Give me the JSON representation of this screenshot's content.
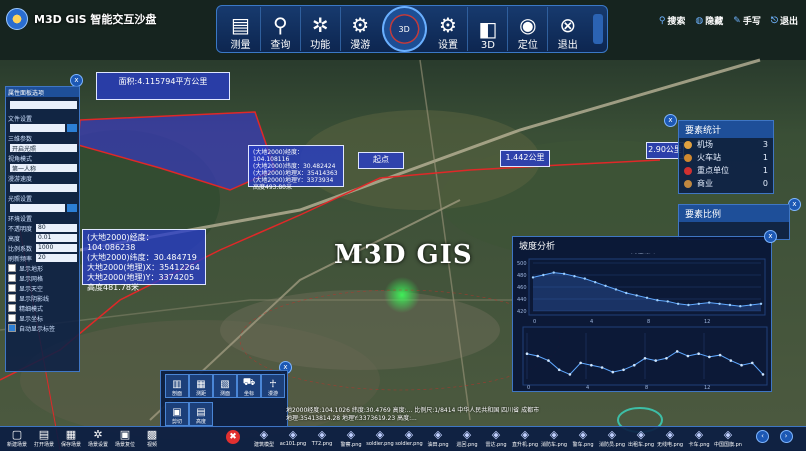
{
  "app": {
    "title": "M3D GIS 智能交互沙盘",
    "watermark": "M3D GIS"
  },
  "toolbar": {
    "items": [
      {
        "label": "测量",
        "icon": "ruler-icon"
      },
      {
        "label": "查询",
        "icon": "search-icon"
      },
      {
        "label": "功能",
        "icon": "gear-icon"
      },
      {
        "label": "漫游",
        "icon": "roam-icon"
      },
      {
        "label": "设置",
        "icon": "settings-icon"
      },
      {
        "label": "3D",
        "icon": "cube-icon"
      },
      {
        "label": "定位",
        "icon": "location-pin-icon"
      },
      {
        "label": "退出",
        "icon": "close-icon"
      }
    ],
    "dial_label": "3D"
  },
  "right_menu": [
    "搜索",
    "隐藏",
    "手写",
    "退出"
  ],
  "left_panel": {
    "title": "属性面板选项",
    "section1": "文件设置",
    "section2": "三维参数",
    "field1_value": "开启光照",
    "field2_label": "视角模式",
    "field2_value": "第一人称",
    "field3_label": "漫游速度",
    "field4_label": "光照设置",
    "field5_label": "环境设置",
    "opacity_label": "不透明度",
    "opacity_value": "80",
    "height_label": "高度",
    "height_value": "0.01",
    "scale_label": "比例系数",
    "scale_value": "1000",
    "rate_label": "刷新频率",
    "rate_value": "20",
    "checks": [
      "显示地形",
      "显示网格",
      "显示天空",
      "显示阴影线",
      "精细模式",
      "显示坐标",
      "自动显示标签"
    ]
  },
  "callouts": {
    "area": "面积:4.115794平方公里",
    "point1": [
      "(大地2000)经度：104.108116",
      "(大地2000)纬度：30.482424",
      "(大地2000)地理X：35414363",
      "(大地2000)地理Y：3373934",
      "高度493.80米"
    ],
    "point2": [
      "(大地2000)经度：104.086238",
      "(大地2000)纬度：30.484719",
      "大地2000(地理)X：35412264",
      "大地2000(地理)Y：3374205",
      "高度481.78米"
    ],
    "start": "起点",
    "dist1": "1.442公里",
    "dist2": "2.90公里"
  },
  "feature_stats": {
    "title": "要素统计",
    "rows": [
      {
        "label": "机场",
        "value": "3",
        "color": "#e0a040"
      },
      {
        "label": "火车站",
        "value": "1",
        "color": "#d08830"
      },
      {
        "label": "重点单位",
        "value": "1",
        "color": "#d03030"
      },
      {
        "label": "商业",
        "value": "0",
        "color": "#c08840"
      }
    ]
  },
  "feature_ratio": {
    "title": "要素比例"
  },
  "profile": {
    "title": "坡度分析",
    "legend": "高程剖面",
    "top_chart": {
      "yticks": [
        "500",
        "480",
        "460",
        "440",
        "420"
      ],
      "xticks": [
        "0",
        "4",
        "8",
        "12"
      ],
      "values": [
        478,
        480,
        482,
        481,
        479,
        477,
        474,
        471,
        468,
        465,
        463,
        461,
        459,
        458,
        456,
        455,
        456,
        457,
        456,
        455,
        454,
        455,
        456
      ]
    },
    "bottom_chart": {
      "xticks": [
        "0",
        "4",
        "8",
        "12"
      ],
      "values": [
        0.55,
        0.5,
        0.4,
        0.2,
        0.1,
        0.35,
        0.3,
        0.25,
        0.15,
        0.2,
        0.3,
        0.45,
        0.4,
        0.45,
        0.6,
        0.5,
        0.55,
        0.48,
        0.52,
        0.4,
        0.3,
        0.35,
        0.1
      ]
    }
  },
  "tool_popup": {
    "items": [
      "剖面",
      "测距",
      "测面",
      "坐标",
      "漫游",
      "剪切",
      "高度"
    ]
  },
  "status": {
    "line1": "地2000经度:104.1026 纬度:30.4769 高度:...  比例尺:1/8414 中华人民共和国 四川省 成都市",
    "line2": "地理:35413814.28 地理Y:3373619.23 高度:..."
  },
  "bottom_bar": {
    "left": [
      "新建场景",
      "打开场景",
      "保存场景",
      "场景设置",
      "场景复位",
      "视频"
    ],
    "files": [
      "建筑模型",
      "ac101.png",
      "T72.png",
      "警察.png",
      "soldier.png",
      "soldier.png",
      "油田.png",
      "巡回.png",
      "雷达.png",
      "直升机.png",
      "消防车.png",
      "警车.png",
      "消防员.png",
      "出租车.png",
      "无线电.png",
      "卡车.png",
      "中国国旗.png"
    ]
  }
}
